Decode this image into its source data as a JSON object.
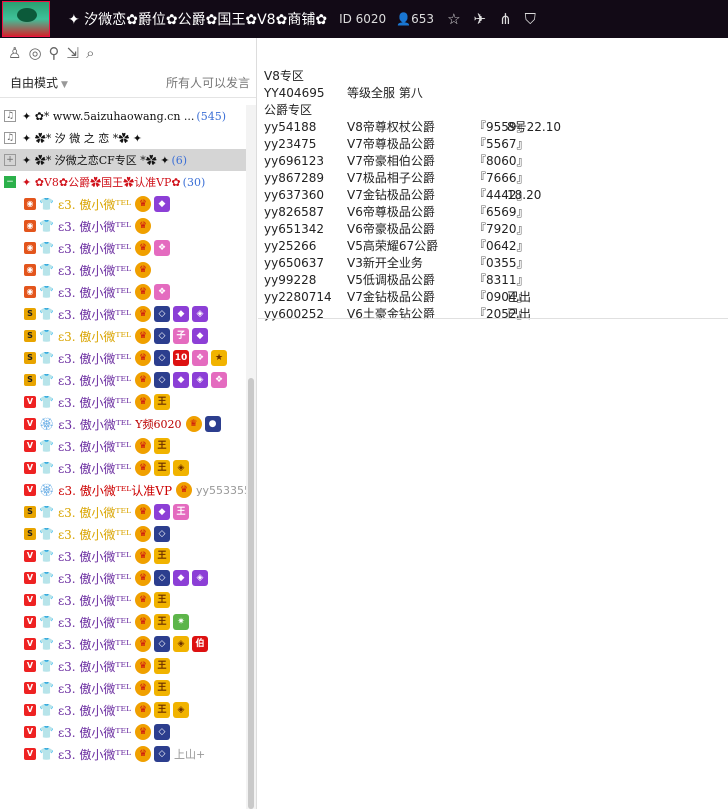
{
  "header": {
    "title": "✦ 汐微恋✿爵位✿公爵✿国王✿V8✿商铺✿",
    "id_label": "ID 6020",
    "online_count": "653"
  },
  "toolbar": {
    "mode_label": "自由模式",
    "permission_label": "所有人可以发言"
  },
  "groups": [
    {
      "name": "✦ ✿* www.5aizuhaowang.cn ...",
      "count": "(545)"
    },
    {
      "name": "✦ ✿*  汐 微 之 恋  *✿ ✦",
      "count": ""
    },
    {
      "name": "✦ ✿*  汐微之恋CF专区 *✿ ✦",
      "count": "(6)"
    },
    {
      "name": "✦  ✿V8✿公爵✿国王✿认准VP✿",
      "count": "(30)"
    }
  ],
  "users": [
    {
      "name": "ε3. 傲小微ᵀᴱᴸ",
      "extra": ""
    },
    {
      "name": "ε3. 傲小微ᵀᴱᴸ",
      "extra": ""
    },
    {
      "name": "ε3. 傲小微ᵀᴱᴸ",
      "extra": ""
    },
    {
      "name": "ε3. 傲小微ᵀᴱᴸ",
      "extra": ""
    },
    {
      "name": "ε3. 傲小微ᵀᴱᴸ",
      "extra": ""
    },
    {
      "name": "ε3. 傲小微ᵀᴱᴸ",
      "extra": ""
    },
    {
      "name": "ε3. 傲小微ᵀᴱᴸ",
      "extra": ""
    },
    {
      "name": "ε3. 傲小微ᵀᴱᴸ",
      "extra": ""
    },
    {
      "name": "ε3. 傲小微ᵀᴱᴸ",
      "extra": ""
    },
    {
      "name": "ε3. 傲小微ᵀᴱᴸ",
      "extra": ""
    },
    {
      "name": "ε3. 傲小微ᵀᴱᴸ",
      "extra": "Y频6020"
    },
    {
      "name": "ε3. 傲小微ᵀᴱᴸ",
      "extra": ""
    },
    {
      "name": "ε3. 傲小微ᵀᴱᴸ",
      "extra": ""
    },
    {
      "name": "ε3. 傲小微ᵀᴱᴸ认准VP",
      "extra": "yy553355"
    },
    {
      "name": "ε3. 傲小微ᵀᴱᴸ",
      "extra": ""
    },
    {
      "name": "ε3. 傲小微ᵀᴱᴸ",
      "extra": ""
    },
    {
      "name": "ε3. 傲小微ᵀᴱᴸ",
      "extra": ""
    },
    {
      "name": "ε3. 傲小微ᵀᴱᴸ",
      "extra": ""
    },
    {
      "name": "ε3. 傲小微ᵀᴱᴸ",
      "extra": ""
    },
    {
      "name": "ε3. 傲小微ᵀᴱᴸ",
      "extra": ""
    },
    {
      "name": "ε3. 傲小微ᵀᴱᴸ",
      "extra": ""
    },
    {
      "name": "ε3. 傲小微ᵀᴱᴸ",
      "extra": ""
    },
    {
      "name": "ε3. 傲小微ᵀᴱᴸ",
      "extra": ""
    },
    {
      "name": "ε3. 傲小微ᵀᴱᴸ",
      "extra": ""
    },
    {
      "name": "ε3. 傲小微ᵀᴱᴸ",
      "extra": ""
    },
    {
      "name": "ε3. 傲小微ᵀᴱᴸ",
      "extra": ""
    },
    {
      "name": "ε3. 傲小微ᵀᴱᴸ",
      "extra": "上山+"
    },
    {
      "name": "ε3. 傲小微ᵀᴱᴸ",
      "extra": ""
    },
    {
      "name": "ε3. 傲小微ᵀᴱᴸ",
      "extra": ""
    }
  ],
  "notice": {
    "lines": [
      [
        "V8专区",
        "",
        "",
        ""
      ],
      [
        "YY404695",
        "等级全服 第八",
        "",
        ""
      ],
      [
        "公爵专区",
        "",
        "",
        ""
      ],
      [
        "yy54188",
        "V8帝尊权杖公爵",
        "『9559』",
        "8号22.10"
      ],
      [
        "yy23475",
        "V7帝尊极品公爵",
        "『5567』",
        ""
      ],
      [
        "yy696123",
        "V7帝豪相伯公爵",
        "『8060』",
        ""
      ],
      [
        "yy867289",
        "V7极品相子公爵",
        "『7666』",
        ""
      ],
      [
        "yy637360",
        "V7金钻极品公爵",
        "『4442』",
        "18.20"
      ],
      [
        "yy826587",
        "V6帝尊极品公爵",
        "『6569』",
        ""
      ],
      [
        "yy651342",
        "V6帝豪极品公爵",
        "『7920』",
        ""
      ],
      [
        "yy25266",
        "V5高荣耀67公爵",
        "『0642』",
        ""
      ],
      [
        "yy650637",
        "V3新开全业务",
        "『0355』",
        ""
      ],
      [
        "yy99228",
        "V5低调极品公爵",
        "『8311』",
        ""
      ],
      [
        "yy2280714",
        "V7金钻极品公爵",
        "『0904』",
        "已出"
      ],
      [
        "yy600252",
        "V6土豪金钻公爵",
        "『2052』",
        "已出"
      ]
    ]
  }
}
